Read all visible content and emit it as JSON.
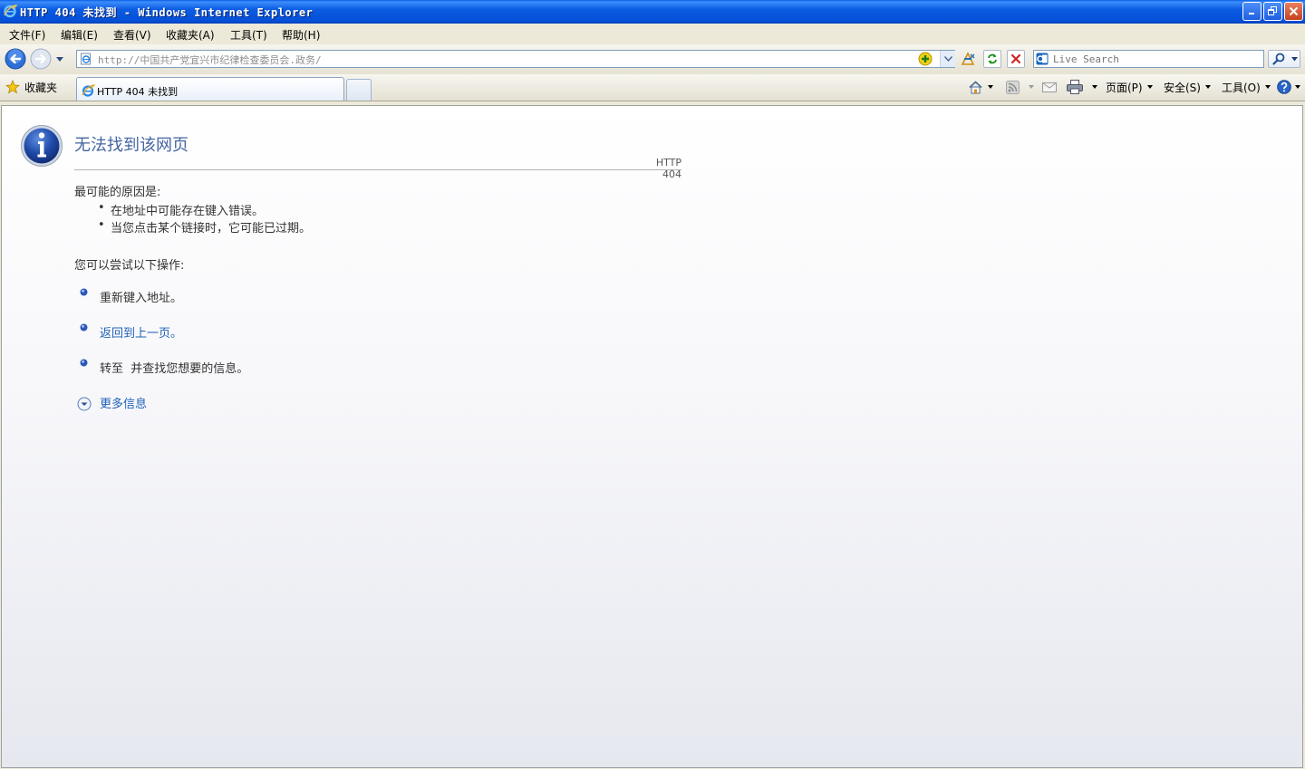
{
  "window": {
    "title": "HTTP 404 未找到 - Windows Internet Explorer",
    "controls": [
      "minimize-icon",
      "restore-icon",
      "close-icon"
    ]
  },
  "menu": {
    "items": [
      {
        "label": "文件(F)"
      },
      {
        "label": "编辑(E)"
      },
      {
        "label": "查看(V)"
      },
      {
        "label": "收藏夹(A)"
      },
      {
        "label": "工具(T)"
      },
      {
        "label": "帮助(H)"
      }
    ]
  },
  "address_bar": {
    "url": "http://中国共产党宜兴市纪律检查委员会.政务/",
    "icons": [
      "back-icon",
      "forward-icon",
      "history-dropdown-icon",
      "page-icon",
      "go-icon",
      "compatibility-view-icon",
      "refresh-icon",
      "stop-icon"
    ]
  },
  "search": {
    "placeholder": "Live Search",
    "icons": [
      "live-search-provider-icon",
      "search-icon"
    ]
  },
  "favorites": {
    "label": "收藏夹"
  },
  "tabs": [
    {
      "label": "HTTP 404 未找到",
      "active": true
    }
  ],
  "command_bar": {
    "page_label": "页面(P)",
    "safety_label": "安全(S)",
    "tools_label": "工具(O)",
    "icons": [
      "home-icon",
      "rss-feed-icon",
      "mail-icon",
      "print-icon",
      "help-icon"
    ]
  },
  "error_page": {
    "title": "无法找到该网页",
    "code": "HTTP 404",
    "causes_heading": "最可能的原因是:",
    "causes": [
      "在地址中可能存在键入错误。",
      "当您点击某个链接时，它可能已过期。"
    ],
    "actions_heading": "您可以尝试以下操作:",
    "actions": {
      "retype": "重新键入地址。",
      "go_back": "返回到上一页。",
      "goto_prefix": "转至",
      "goto_suffix": "并查找您想要的信息。"
    },
    "more_info": "更多信息"
  },
  "colors": {
    "titlebar": "#0550d8",
    "link": "#1f61b8",
    "heading": "#4465a2",
    "chrome": "#ece9d8"
  }
}
